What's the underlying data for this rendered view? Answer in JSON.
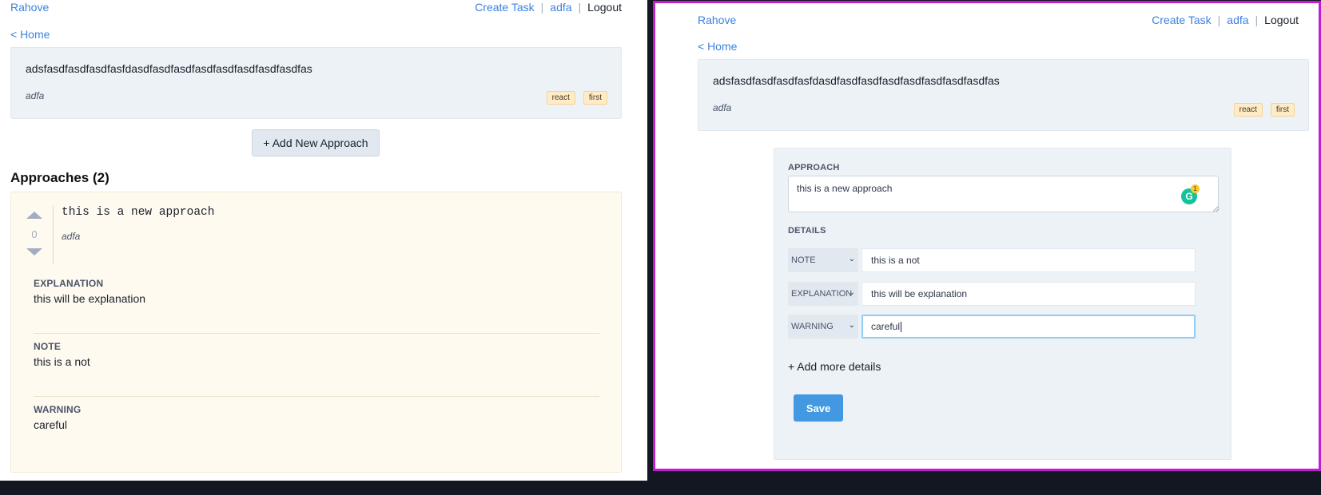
{
  "nav": {
    "brand": "Rahove",
    "create_task": "Create Task",
    "user": "adfa",
    "logout": "Logout",
    "separator": "|"
  },
  "home_link": "< Home",
  "task": {
    "title": "adsfasdfasdfasdfasfdasdfasdfasdfasdfasdfasdfasdfasdfas",
    "author": "adfa",
    "tags": [
      "react",
      "first"
    ]
  },
  "left": {
    "add_approach_button": "+ Add New Approach",
    "approaches_heading": "Approaches (2)",
    "approach": {
      "text": "this is a new approach",
      "author": "adfa",
      "votes": "0",
      "details": [
        {
          "label": "EXPLANATION",
          "value": "this will be explanation"
        },
        {
          "label": "NOTE",
          "value": "this is a not"
        },
        {
          "label": "WARNING",
          "value": "careful"
        }
      ]
    }
  },
  "form": {
    "approach_label": "APPROACH",
    "approach_value": "this is a new approach",
    "details_label": "DETAILS",
    "grammarly_count": "1",
    "rows": [
      {
        "type": "NOTE",
        "value": "this is a not"
      },
      {
        "type": "EXPLANATION",
        "value": "this will be explanation"
      },
      {
        "type": "WARNING",
        "value": "careful"
      }
    ],
    "add_more": "+ Add more details",
    "save": "Save"
  },
  "colors": {
    "link": "#3b82e0",
    "save_button": "#4299e1",
    "window_highlight": "#c21bd0",
    "approach_card_bg": "#fffaf0",
    "tag_bg": "#feebc8"
  }
}
